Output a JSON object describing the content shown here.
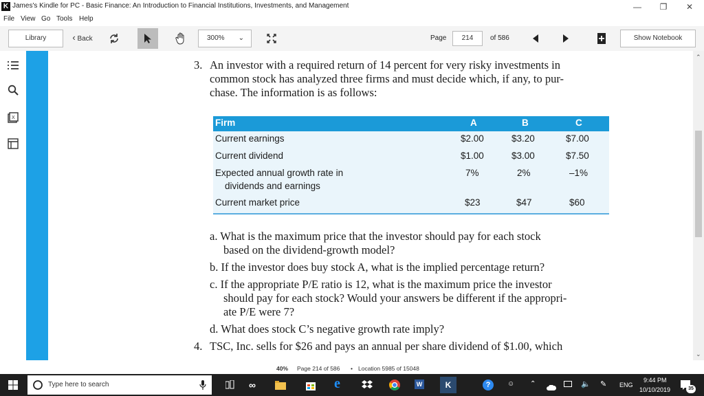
{
  "window": {
    "title": "James's Kindle for PC - Basic Finance: An Introduction to Financial Institutions, Investments, and Management"
  },
  "menu": [
    "File",
    "View",
    "Go",
    "Tools",
    "Help"
  ],
  "toolbar": {
    "library": "Library",
    "back": "Back",
    "zoom": "300%",
    "page_label": "Page",
    "page_value": "214",
    "of_label": "of 586",
    "show_notebook": "Show Notebook"
  },
  "book": {
    "q3_number": "3.",
    "q3_lines": [
      "An investor with a required return of 14 percent for very risky investments in",
      "common stock has analyzed three firms and must decide which, if any, to pur-",
      "chase. The information is as follows:"
    ],
    "table": {
      "headers": [
        "Firm",
        "A",
        "B",
        "C"
      ],
      "rows": [
        {
          "label": "Current earnings",
          "values": [
            "$2.00",
            "$3.20",
            "$7.00"
          ]
        },
        {
          "label": "Current dividend",
          "values": [
            "$1.00",
            "$3.00",
            "$7.50"
          ]
        },
        {
          "label": "Expected annual growth rate in",
          "label2": "dividends and earnings",
          "values": [
            "7%",
            "2%",
            "–1%"
          ]
        },
        {
          "label": "Current market price",
          "values": [
            "$23",
            "$47",
            "$60"
          ]
        }
      ]
    },
    "qa_lines": [
      "a. What is the maximum price that the investor should pay for each stock",
      "based on the dividend-growth model?"
    ],
    "qb_lines": [
      "b. If the investor does buy stock A, what is the implied percentage return?"
    ],
    "qc_lines": [
      "c. If the appropriate P/E ratio is 12, what is the maximum price the investor",
      "should pay for each stock? Would your answers be different if the appropri-",
      "ate P/E were 7?"
    ],
    "qd_lines": [
      "d. What does stock C’s negative growth rate imply?"
    ],
    "q4_number": "4.",
    "q4_line": "TSC, Inc. sells for $26 and pays an annual per share dividend of $1.00, which"
  },
  "status": {
    "percent": "40%",
    "page_info": "Page 214 of 586",
    "separator": "•",
    "location": "Location 5985 of 15048"
  },
  "taskbar": {
    "search_placeholder": "Type here to search",
    "language": "ENG",
    "time": "9:44 PM",
    "date": "10/10/2019",
    "notifications": "35"
  },
  "colors": {
    "accent": "#1da1e6",
    "table_header": "#1b9ad8",
    "table_bg": "#eaf5fb"
  }
}
